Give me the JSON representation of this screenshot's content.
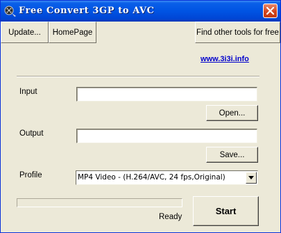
{
  "window": {
    "title": "Free Convert 3GP to AVC",
    "icon": "film-reel-icon",
    "close_icon": "close-icon"
  },
  "toolbar": {
    "update_label": "Update...",
    "homepage_label": "HomePage",
    "other_tools_label": "Find other tools for free"
  },
  "link": {
    "text": "www.3i3i.info"
  },
  "form": {
    "input_label": "Input",
    "input_value": "",
    "open_label": "Open...",
    "output_label": "Output",
    "output_value": "",
    "save_label": "Save...",
    "profile_label": "Profile",
    "profile_selected": "MP4 Video - (H.264/AVC, 24 fps,Original)"
  },
  "progress": {
    "value": 0
  },
  "status": {
    "text": "Ready"
  },
  "start": {
    "label": "Start"
  },
  "colors": {
    "title_bar": "#0054e3",
    "close_button": "#d2451e",
    "link": "#0000cc",
    "background": "#ece9d8"
  }
}
